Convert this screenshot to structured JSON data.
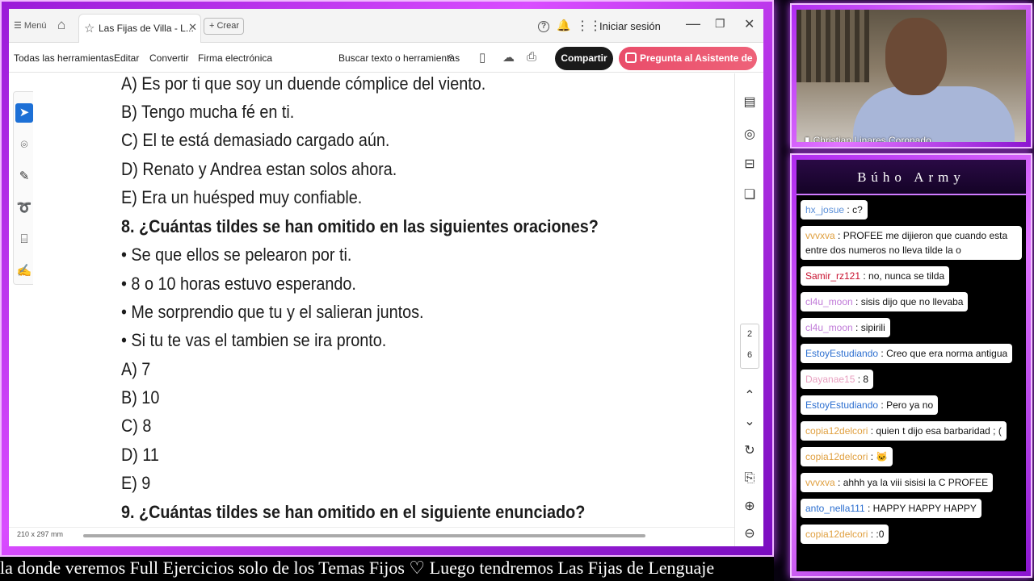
{
  "titlebar": {
    "menu": "☰ Menú",
    "tab_title": "Las Fijas de Villa - L...",
    "new_button": "+ Crear",
    "login": "Iniciar sesión"
  },
  "toolbar": {
    "all_tools": "Todas las herramientas",
    "edit": "Editar",
    "convert": "Convertir",
    "sign": "Firma electrónica",
    "search": "Buscar texto o herramientas",
    "share": "Compartir",
    "ai": "Pregunta al Asistente de IA"
  },
  "document": {
    "lines": [
      "A) Es por ti que soy un duende cómplice del viento.",
      "B) Tengo mucha fé en ti.",
      "C) El te está demasiado cargado aún.",
      "D) Renato y Andrea estan solos ahora.",
      "E) Era un huésped muy confiable.",
      "8. ¿Cuántas tildes se han omitido en las siguientes oraciones?",
      "• Se que ellos se pelearon por ti.",
      "• 8 o 10 horas estuvo esperando.",
      "• Me sorprendio que tu y el salieran juntos.",
      "• Si tu te vas el tambien se ira pronto.",
      "A) 7",
      "B) 10",
      "C) 8",
      "D) 11",
      "E) 9",
      "9. ¿Cuántas tildes se han omitido en el siguiente enunciado?"
    ],
    "page_size": "210 x 297 mm",
    "page_current": "2",
    "page_total": "6"
  },
  "ticker": "la donde veremos Full Ejercicios solo de los Temas Fijos   ♡   Luego tendremos Las Fijas de Lenguaje",
  "webcam": {
    "name": "Christian Linares Coronado"
  },
  "chat": {
    "title": "Búho Army",
    "messages": [
      {
        "user": "hx_josue",
        "color": "#5a8fd8",
        "text": "c?"
      },
      {
        "user": "vvvxva",
        "color": "#e0a040",
        "text": "PROFEE me dijieron que cuando esta entre dos numeros no lleva tilde la o"
      },
      {
        "user": "Samir_rz121",
        "color": "#c8102e",
        "text": "no, nunca se tilda"
      },
      {
        "user": "cl4u_moon",
        "color": "#c07ad8",
        "text": "sisis dijo que no llevaba"
      },
      {
        "user": "cl4u_moon",
        "color": "#c07ad8",
        "text": "sipirili"
      },
      {
        "user": "EstoyEstudiando",
        "color": "#2c6fd0",
        "text": "Creo que era norma antigua"
      },
      {
        "user": "Dayanae15",
        "color": "#e8a0c0",
        "text": "8"
      },
      {
        "user": "EstoyEstudiando",
        "color": "#2c6fd0",
        "text": "Pero ya no"
      },
      {
        "user": "copia12delcori",
        "color": "#e0a040",
        "text": "quien t dijo esa barbaridad ; ("
      },
      {
        "user": "copia12delcori",
        "color": "#e0a040",
        "text": "🐱"
      },
      {
        "user": "vvvxva",
        "color": "#e0a040",
        "text": "ahhh ya la viii sisisi la C PROFEE"
      },
      {
        "user": "anto_nella111",
        "color": "#2c6fd0",
        "text": "HAPPY HAPPY HAPPY"
      },
      {
        "user": "copia12delcori",
        "color": "#e0a040",
        "text": ":0"
      }
    ]
  }
}
